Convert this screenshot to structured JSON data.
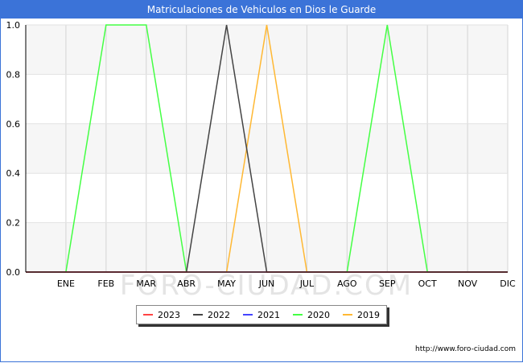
{
  "chart_data": {
    "type": "line",
    "title": "Matriculaciones de Vehiculos en Dios le Guarde",
    "categories": [
      "",
      "ENE",
      "FEB",
      "MAR",
      "ABR",
      "MAY",
      "JUN",
      "JUL",
      "AGO",
      "SEP",
      "OCT",
      "NOV",
      "DIC"
    ],
    "ylim": [
      0,
      1
    ],
    "yticks": [
      "0.0",
      "0.2",
      "0.4",
      "0.6",
      "0.8",
      "1.0"
    ],
    "grid": true,
    "legend_position": "bottom-center",
    "series": [
      {
        "name": "2023",
        "color": "#ff4444",
        "values": [
          0,
          0,
          0,
          0,
          0,
          0,
          0,
          0,
          0,
          0,
          0,
          0,
          0
        ]
      },
      {
        "name": "2022",
        "color": "#444444",
        "values": [
          0,
          0,
          0,
          0,
          0,
          1,
          0,
          0,
          0,
          0,
          0,
          0,
          0
        ]
      },
      {
        "name": "2021",
        "color": "#4444ff",
        "values": [
          0,
          0,
          0,
          0,
          0,
          0,
          0,
          0,
          0,
          0,
          0,
          0,
          0
        ]
      },
      {
        "name": "2020",
        "color": "#44ff44",
        "values": [
          0,
          0,
          1,
          1,
          0,
          0,
          0,
          0,
          0,
          1,
          0,
          0,
          0
        ]
      },
      {
        "name": "2019",
        "color": "#ffb833",
        "values": [
          0,
          0,
          0,
          0,
          0,
          0,
          1,
          0,
          0,
          0,
          0,
          0,
          0
        ]
      }
    ]
  },
  "watermark": "FORO-CIUDAD.COM",
  "source": "http://www.foro-ciudad.com"
}
